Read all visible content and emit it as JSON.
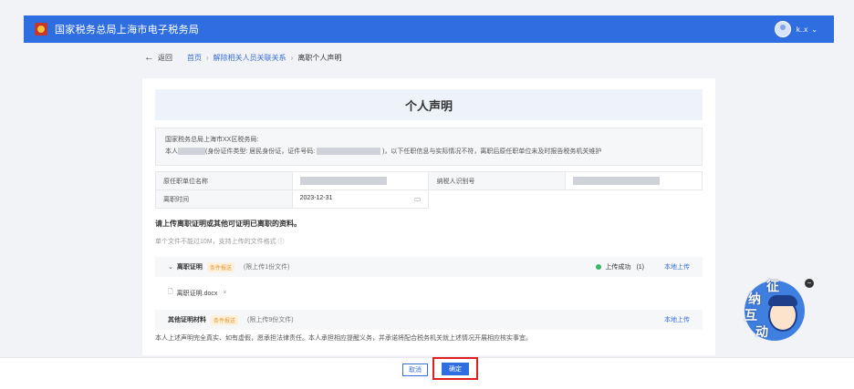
{
  "header": {
    "title": "国家税务总局上海市电子税务局",
    "user_name": "k..x"
  },
  "breadcrumb": {
    "back_label": "返回",
    "items": [
      "首页",
      "解除相关人员关联关系",
      "离职个人声明"
    ]
  },
  "card": {
    "title": "个人声明",
    "intro_line1": "国家税务总局上海市XX区税务局:",
    "intro_line2_a": "本人",
    "intro_line2_b": "(身份证件类型:",
    "intro_line2_c": "居民身份证，证件号码:",
    "intro_line2_d": ")，以下任职信息与实际情况不符，离职后原任职单位未及时报告税务机关维护",
    "fields": {
      "org_label": "原任职单位名称",
      "taxid_label": "纳税人识别号",
      "leave_label": "离职时间",
      "leave_value": "2023-12-31"
    },
    "upload_title": "请上传离职证明或其他可证明已离职的资料。",
    "upload_hint": "单个文件不能过10M，支持上传的文件格式 ⓘ",
    "rows": [
      {
        "name": "离职证明",
        "tag": "条件报送",
        "limit": "(限上传1份文件)",
        "status": "上传成功",
        "count": "(1)",
        "action": "本地上传"
      },
      {
        "name": "其他证明材料",
        "tag": "条件报送",
        "limit": "(限上传9份文件)",
        "action": "本地上传"
      }
    ],
    "file_name": "离职证明.docx",
    "declaration": "本人上述声明完全真实、如有虚假，愿承担法律责任。本人承担相应提醒义务，并承诺将配合税务机关就上述情况开展相应核实事宜。"
  },
  "footer": {
    "cancel_label": "取消",
    "confirm_label": "确定"
  },
  "assistant": {
    "chars": [
      "征",
      "纳",
      "互",
      "动"
    ]
  },
  "colors": {
    "primary": "#2f6ee0",
    "highlight": "#e02020",
    "success": "#3cb66a",
    "tag": "#e7982d"
  }
}
